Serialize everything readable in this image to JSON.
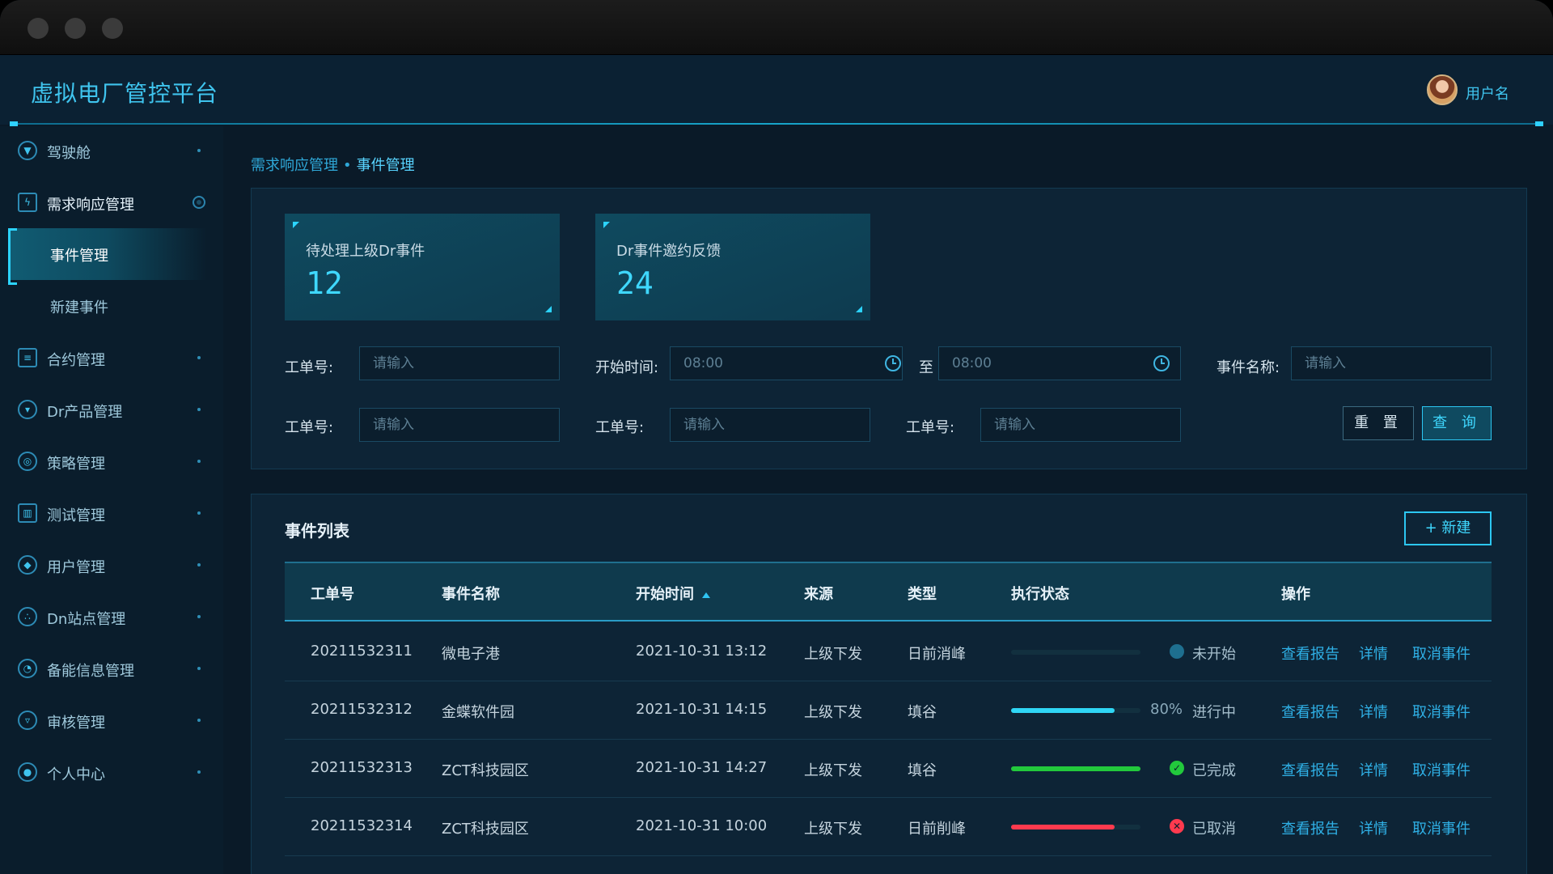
{
  "app": {
    "title": "虚拟电厂管控平台",
    "username": "用户名"
  },
  "sidebar": {
    "items": [
      {
        "label": "驾驶舱",
        "icon": "cockpit-icon"
      },
      {
        "label": "需求响应管理",
        "icon": "bolt-icon",
        "open": true,
        "children": [
          {
            "label": "事件管理",
            "active": true
          },
          {
            "label": "新建事件"
          }
        ]
      },
      {
        "label": "合约管理",
        "icon": "contract-icon"
      },
      {
        "label": "Dr产品管理",
        "icon": "product-icon"
      },
      {
        "label": "策略管理",
        "icon": "strategy-icon"
      },
      {
        "label": "测试管理",
        "icon": "chart-icon"
      },
      {
        "label": "用户管理",
        "icon": "user-shield-icon"
      },
      {
        "label": "Dn站点管理",
        "icon": "site-icon"
      },
      {
        "label": "备能信息管理",
        "icon": "energy-icon"
      },
      {
        "label": "审核管理",
        "icon": "audit-icon"
      },
      {
        "label": "个人中心",
        "icon": "person-icon"
      }
    ]
  },
  "breadcrumb": {
    "parent": "需求响应管理",
    "separator": "•",
    "current": "事件管理"
  },
  "stats": [
    {
      "label": "待处理上级Dr事件",
      "value": "12"
    },
    {
      "label": "Dr事件邀约反馈",
      "value": "24"
    }
  ],
  "filters": {
    "order_no_label": "工单号:",
    "start_time_label": "开始时间:",
    "to_label": "至",
    "event_name_label": "事件名称:",
    "placeholder": "请输入",
    "time_from": "08:00",
    "time_to": "08:00",
    "reset_label": "重 置",
    "query_label": "查 询"
  },
  "list": {
    "title": "事件列表",
    "new_label": "+ 新建",
    "columns": [
      "工单号",
      "事件名称",
      "开始时间",
      "来源",
      "类型",
      "执行状态",
      "操作"
    ],
    "rows": [
      {
        "id": "20211532311",
        "name": "微电子港",
        "start": "2021-10-31  13:12",
        "source": "上级下发",
        "type": "日前消峰",
        "progress": 0,
        "percent": "",
        "status": "未开始",
        "status_color": "#1e6f8f",
        "bar_color": "#12303f",
        "status_icon": ""
      },
      {
        "id": "20211532312",
        "name": "金蝶软件园",
        "start": "2021-10-31  14:15",
        "source": "上级下发",
        "type": "填谷",
        "progress": 0.8,
        "percent": "80%",
        "status": "进行中",
        "status_color": "",
        "bar_color": "#2fd6f5",
        "status_icon": ""
      },
      {
        "id": "20211532313",
        "name": "ZCT科技园区",
        "start": "2021-10-31  14:27",
        "source": "上级下发",
        "type": "填谷",
        "progress": 1.0,
        "percent": "",
        "status": "已完成",
        "status_color": "#22c93c",
        "bar_color": "#22c93c",
        "status_icon": "✓"
      },
      {
        "id": "20211532314",
        "name": "ZCT科技园区",
        "start": "2021-10-31  10:00",
        "source": "上级下发",
        "type": "日前削峰",
        "progress": 0.8,
        "percent": "",
        "status": "已取消",
        "status_color": "#ff3a4e",
        "bar_color": "#ff3a4e",
        "status_icon": "✕"
      }
    ],
    "actions": [
      "查看报告",
      "详情",
      "取消事件"
    ]
  }
}
